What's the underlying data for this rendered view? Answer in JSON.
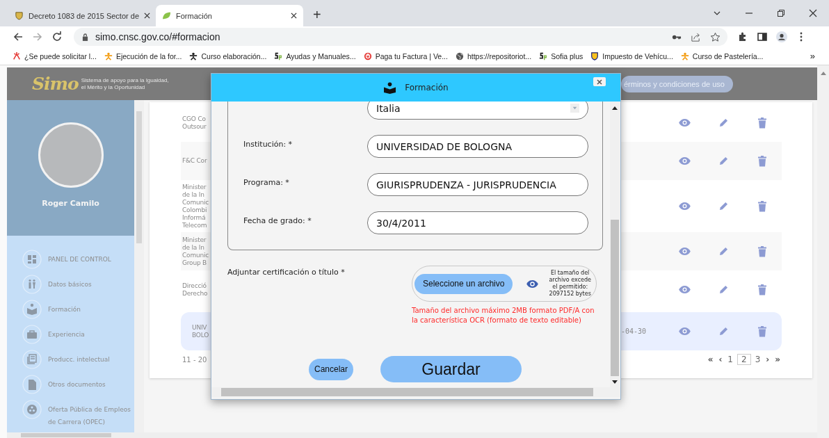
{
  "browser": {
    "tabs": [
      {
        "title": "Decreto 1083 de 2015 Sector de",
        "selected": false
      },
      {
        "title": "Formación",
        "selected": true
      }
    ],
    "new_tab": "+",
    "url": "simo.cnsc.gov.co/#formacion",
    "bookmarks": [
      {
        "label": "¿Se puede solicitar l..."
      },
      {
        "label": "Ejecución de la for..."
      },
      {
        "label": "Curso elaboración..."
      },
      {
        "label": "Ayudas y Manuales..."
      },
      {
        "label": "Paga tu Factura | Ve..."
      },
      {
        "label": "https://repositoriot..."
      },
      {
        "label": "Sofia plus"
      },
      {
        "label": "Impuesto de Vehícu..."
      },
      {
        "label": "Curso de Pastelería..."
      }
    ],
    "more_bookmarks": "»"
  },
  "header": {
    "logo": "Simo",
    "tagline": [
      "Sistema de apoyo para la Igualdad,",
      "el Mérito y la Oportunidad"
    ],
    "terms_link": "érminos y condiciones de uso"
  },
  "sidebar": {
    "user_name": "Roger Camilo",
    "items": [
      {
        "label": "PANEL DE CONTROL"
      },
      {
        "label": "Datos básicos"
      },
      {
        "label": "Formación"
      },
      {
        "label": "Experiencia"
      },
      {
        "label": "Producc. intelectual"
      },
      {
        "label": "Otros documentos"
      },
      {
        "label": "Oferta Pública de Empleos de Carrera (OPEC)"
      }
    ]
  },
  "table": {
    "rows": [
      {
        "lines": [
          "CGO Co",
          "Outsour"
        ],
        "selected": false
      },
      {
        "lines": [
          "F&C Cor"
        ],
        "selected": false
      },
      {
        "lines": [
          "Minister",
          "de la In",
          "Comunic",
          "Colombi",
          "Informá",
          "Telecom"
        ],
        "selected": false
      },
      {
        "lines": [
          "Minister",
          "de la In",
          "Comunic",
          "Group B"
        ],
        "selected": false
      },
      {
        "lines": [
          "Direcció",
          "Derecho"
        ],
        "selected": false
      },
      {
        "lines": [
          "UNIV",
          "BOLO"
        ],
        "date": "-04-30",
        "selected": true
      }
    ]
  },
  "pagination": {
    "range": "11 - 20",
    "controls": [
      {
        "label": "«",
        "kind": "nav",
        "selected": false
      },
      {
        "label": "‹",
        "kind": "nav",
        "selected": false
      },
      {
        "label": "1",
        "kind": "page",
        "selected": false
      },
      {
        "label": "2",
        "kind": "page",
        "selected": true
      },
      {
        "label": "3",
        "kind": "page",
        "selected": false
      },
      {
        "label": "›",
        "kind": "nav",
        "selected": false
      },
      {
        "label": "»",
        "kind": "nav",
        "selected": false
      }
    ]
  },
  "modal": {
    "title": "Formación",
    "fields": [
      {
        "kind": "select",
        "value": "Italia"
      },
      {
        "kind": "text",
        "label": "Institución: *",
        "value": "UNIVERSIDAD DE BOLOGNA"
      },
      {
        "kind": "text",
        "label": "Programa: *",
        "value": "GIURISPRUDENZA - JURISPRUDENCIA"
      },
      {
        "kind": "text",
        "label": "Fecha de grado: *",
        "value": "30/4/2011"
      }
    ],
    "attachment": {
      "label": "Adjuntar certificación o título *",
      "button": "Seleccione un archivo",
      "size_message": "El tamaño del archivo excede el permitido: 2097152 bytes",
      "hint": "Tamaño del archivo máximo 2MB formato PDF/A con la característica OCR (formato de texto editable)"
    },
    "buttons": [
      {
        "label": "Cancelar",
        "kind": "secondary"
      },
      {
        "label": "Guardar",
        "kind": "primary"
      }
    ]
  }
}
